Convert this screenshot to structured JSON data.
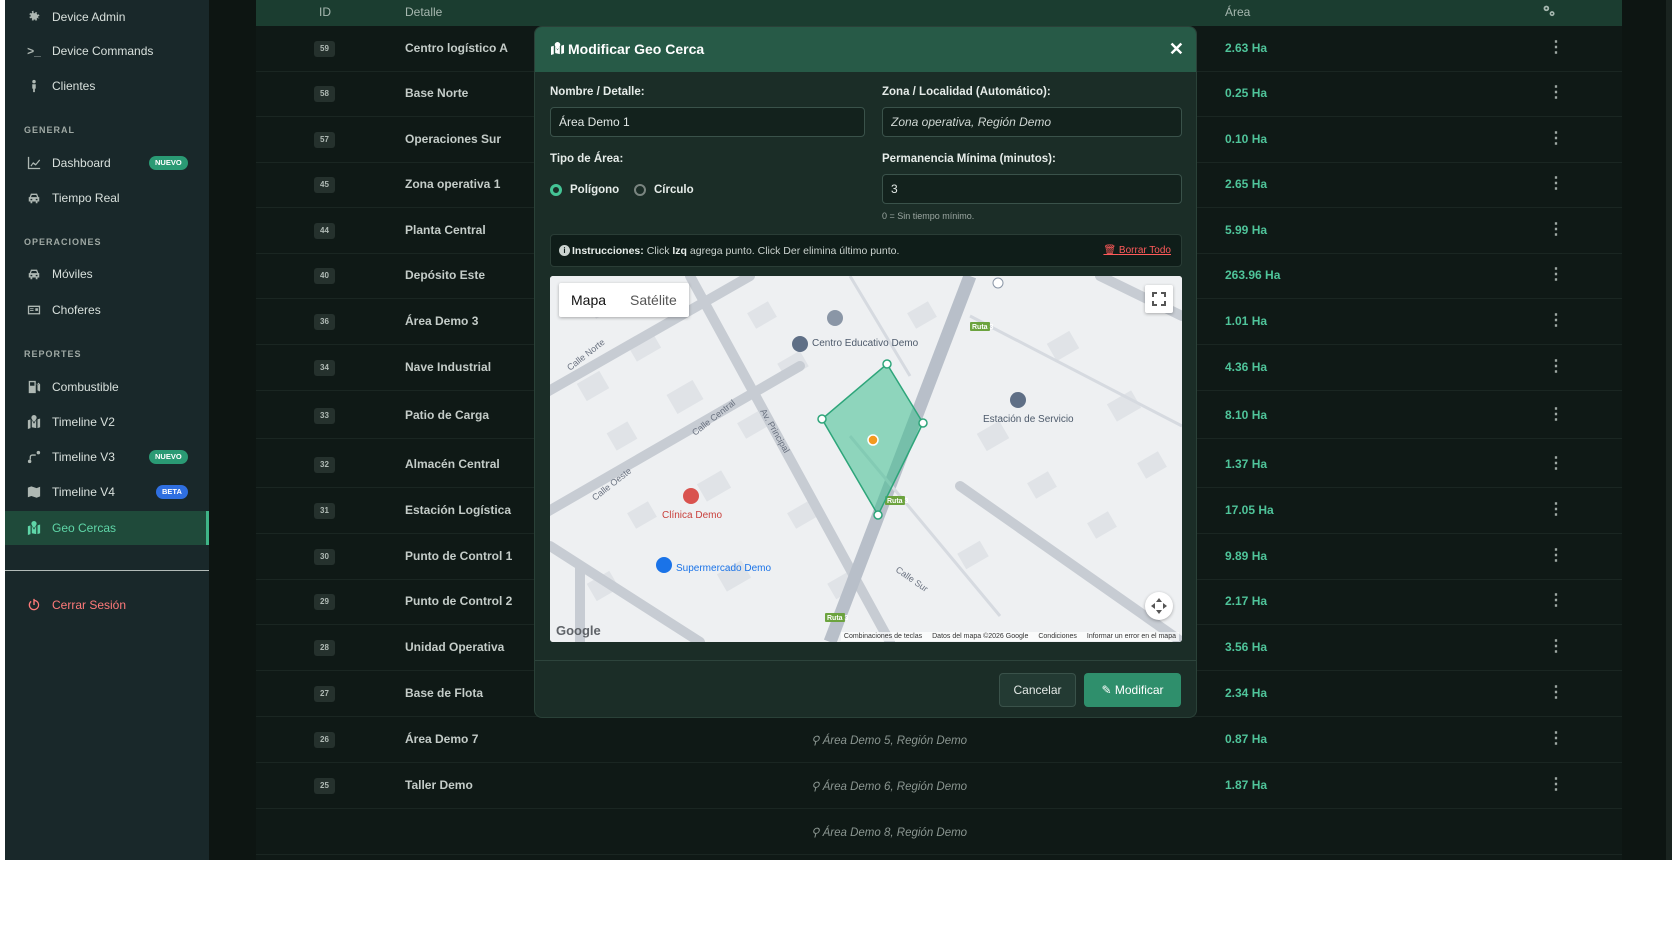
{
  "sidebar": {
    "items_top": [
      {
        "label": "Device Admin",
        "icon": "gear-icon"
      },
      {
        "label": "Device Commands",
        "icon": "terminal-icon"
      },
      {
        "label": "Clientes",
        "icon": "person-icon"
      }
    ],
    "section_general": "GENERAL",
    "general_items": [
      {
        "label": "Dashboard",
        "icon": "chart-line-icon",
        "badge": "NUEVO"
      },
      {
        "label": "Tiempo Real",
        "icon": "car-icon"
      }
    ],
    "section_operaciones": "OPERACIONES",
    "operaciones_items": [
      {
        "label": "Móviles",
        "icon": "car-icon"
      },
      {
        "label": "Choferes",
        "icon": "id-card-icon"
      }
    ],
    "section_reportes": "REPORTES",
    "reportes_items": [
      {
        "label": "Combustible",
        "icon": "fuel-pump-icon"
      },
      {
        "label": "Timeline V2",
        "icon": "map-marked-icon"
      },
      {
        "label": "Timeline V3",
        "icon": "route-icon",
        "badge": "NUEVO"
      },
      {
        "label": "Timeline V4",
        "icon": "map-icon",
        "badge": "BETA"
      },
      {
        "label": "Geo Cercas",
        "icon": "map-marked-icon"
      }
    ],
    "logout": "Cerrar Sesión",
    "colors": {
      "badge_green": "#2a9a74",
      "badge_blue": "#2f6fe0",
      "active": "#5fd6a8",
      "logout": "#ff7a7a"
    }
  },
  "table": {
    "headers": {
      "id": "ID",
      "detalle": "Detalle",
      "area": "Área"
    },
    "rows": [
      {
        "id": "59",
        "detalle": "Centro logístico A",
        "zona": "",
        "area": "2.63 Ha"
      },
      {
        "id": "58",
        "detalle": "Base Norte",
        "zona": "",
        "area": "0.25 Ha"
      },
      {
        "id": "57",
        "detalle": "Operaciones Sur",
        "zona": "",
        "area": "0.10 Ha"
      },
      {
        "id": "45",
        "detalle": "Zona operativa 1",
        "zona": "",
        "area": "2.65 Ha"
      },
      {
        "id": "44",
        "detalle": "Planta Central",
        "zona": "",
        "area": "5.99 Ha"
      },
      {
        "id": "40",
        "detalle": "Depósito Este",
        "zona": "",
        "area": "263.96 Ha"
      },
      {
        "id": "36",
        "detalle": "Área Demo 3",
        "zona": "",
        "area": "1.01 Ha"
      },
      {
        "id": "34",
        "detalle": "Nave Industrial",
        "zona": "",
        "area": "4.36 Ha"
      },
      {
        "id": "33",
        "detalle": "Patio de Carga",
        "zona": "",
        "area": "8.10 Ha"
      },
      {
        "id": "32",
        "detalle": "Almacén Central",
        "zona": "",
        "area": "1.37 Ha"
      },
      {
        "id": "31",
        "detalle": "Estación Logística",
        "zona": "",
        "area": "17.05 Ha"
      },
      {
        "id": "30",
        "detalle": "Punto de Control 1",
        "zona": "",
        "area": "9.89 Ha"
      },
      {
        "id": "29",
        "detalle": "Punto de Control 2",
        "zona": "",
        "area": "2.17 Ha"
      },
      {
        "id": "28",
        "detalle": "Unidad Operativa",
        "zona": "",
        "area": "3.56 Ha"
      },
      {
        "id": "27",
        "detalle": "Base de Flota",
        "zona": "",
        "area": "2.34 Ha"
      },
      {
        "id": "26",
        "detalle": "Área Demo 7",
        "zona": "Área Demo 5, Región Demo",
        "area": "0.87 Ha"
      },
      {
        "id": "25",
        "detalle": "Taller Demo",
        "zona": "Área Demo 6, Región Demo",
        "area": "1.87 Ha"
      },
      {
        "id": "",
        "detalle": "",
        "zona": "Área Demo 8, Región Demo",
        "area": ""
      }
    ],
    "area_color": "#4fc49a"
  },
  "modal": {
    "title": "Modificar Geo Cerca",
    "nombre_label": "Nombre / Detalle:",
    "nombre_value": "Área Demo 1",
    "zona_label": "Zona / Localidad (Automático):",
    "zona_value": "Zona operativa, Región Demo",
    "tipo_label": "Tipo de Área:",
    "tipo_options": [
      "Polígono",
      "Círculo"
    ],
    "tipo_selected": "Polígono",
    "permanencia_label": "Permanencia Mínima (minutos):",
    "permanencia_value": "3",
    "permanencia_hint": "0 = Sin tiempo mínimo.",
    "instr_label": "Instrucciones:",
    "instr_text_1": "Click",
    "instr_izq": "Izq",
    "instr_text_2": "agrega punto. Click Der elimina último punto.",
    "borrar_todo": "Borrar Todo",
    "cancel": "Cancelar",
    "modify": "Modificar",
    "accent": "#2f8f6c",
    "header_color": "#275a47"
  },
  "map": {
    "tab_map": "Mapa",
    "tab_satellite": "Satélite",
    "google": "Google",
    "attribution": [
      "Combinaciones de teclas",
      "Datos del mapa ©2026 Google",
      "Condiciones",
      "Informar un error en el mapa"
    ],
    "pois": [
      {
        "label": "Centro Educativo Demo",
        "color": "#5f6f86"
      },
      {
        "label": "Estación de Servicio",
        "color": "#5f6f86"
      },
      {
        "label": "Clínica Demo",
        "color": "#d9534f"
      },
      {
        "label": "Supermercado Demo",
        "color": "#1a73e8"
      }
    ],
    "streets": [
      "Calle Norte",
      "Calle Central",
      "Av. Principal",
      "Calle Sur",
      "Calle Oeste"
    ],
    "route_shields": [
      "Ruta 3",
      "Ruta 3",
      "Ruta 3"
    ],
    "geofence_color": "#3fbf8f"
  }
}
